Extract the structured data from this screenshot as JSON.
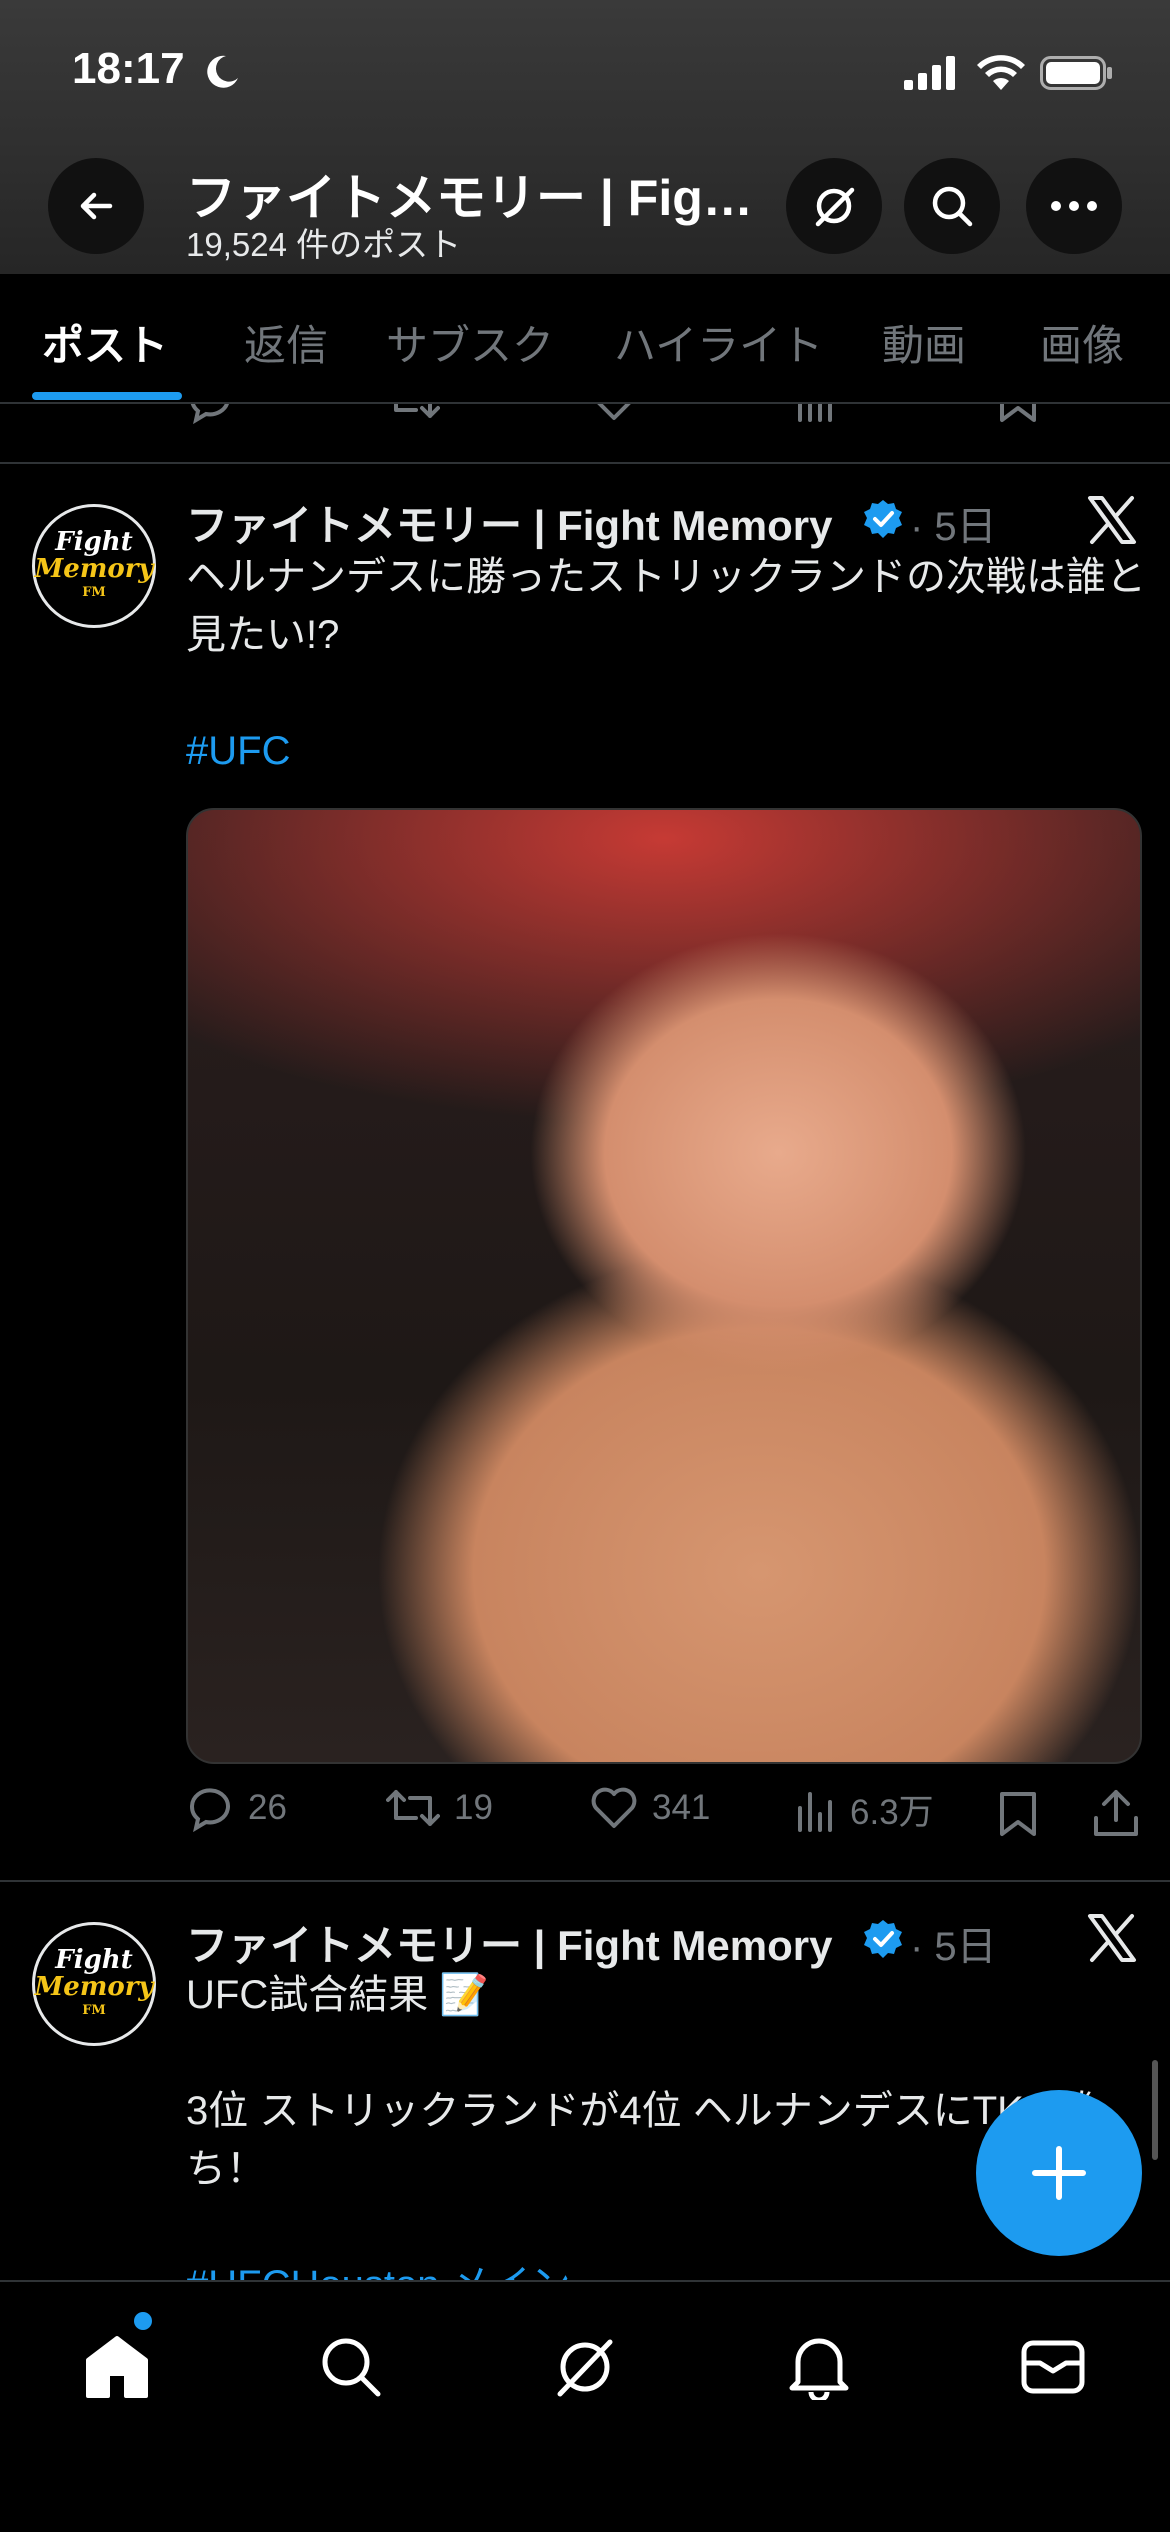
{
  "status_bar": {
    "time": "18:17"
  },
  "header": {
    "title": "ファイトメモリー | Figh…",
    "subtitle": "19,524 件のポスト"
  },
  "tabs": [
    {
      "label": "ポスト",
      "active": true
    },
    {
      "label": "返信",
      "active": false
    },
    {
      "label": "サブスク",
      "active": false
    },
    {
      "label": "ハイライト",
      "active": false
    },
    {
      "label": "動画",
      "active": false
    },
    {
      "label": "画像",
      "active": false
    }
  ],
  "posts": [
    {
      "author": "ファイトメモリー | Fight Memory",
      "age": "· 5日",
      "text": "ヘルナンデスに勝ったストリックランドの次戦は誰と見たい!?",
      "hashtag": "#UFC",
      "replies": "26",
      "reposts": "19",
      "likes": "341",
      "views": "6.3万"
    },
    {
      "author": "ファイトメモリー | Fight Memory",
      "age": "· 5日",
      "text_line1": "UFC試合結果 📝",
      "text_line2": "3位 ストリックランドが4位 ヘルナンデスにTKO勝ち！",
      "text_line3": "#UFCHouston メイン"
    }
  ],
  "avatar": {
    "line1": "Fight",
    "line2": "Memory",
    "line3": "FM"
  },
  "colors": {
    "accent": "#1d9bf0",
    "background": "#000000",
    "secondary_text": "#71767b"
  }
}
